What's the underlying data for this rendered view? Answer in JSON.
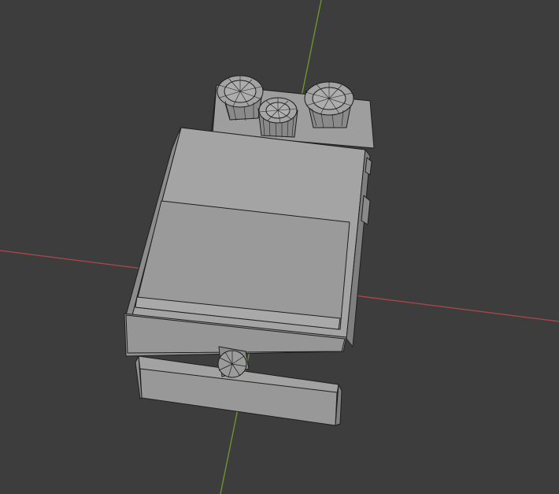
{
  "viewport": {
    "background": "#3d3d3d",
    "axis_x_color": "#b0474c",
    "axis_y_color": "#6f9a2e",
    "model_fill": "#9a9a9a",
    "model_fill_light": "#a6a6a6",
    "model_fill_dark": "#858585",
    "edge_color": "#1e1e1e"
  },
  "scene": {
    "object": "guitar-effects-pedal",
    "knobs": [
      "top-left-knob",
      "top-center-knob",
      "top-right-knob",
      "front-foot-knob"
    ],
    "side_jacks": [
      "right-side-jack-upper",
      "right-side-jack-lower"
    ]
  }
}
